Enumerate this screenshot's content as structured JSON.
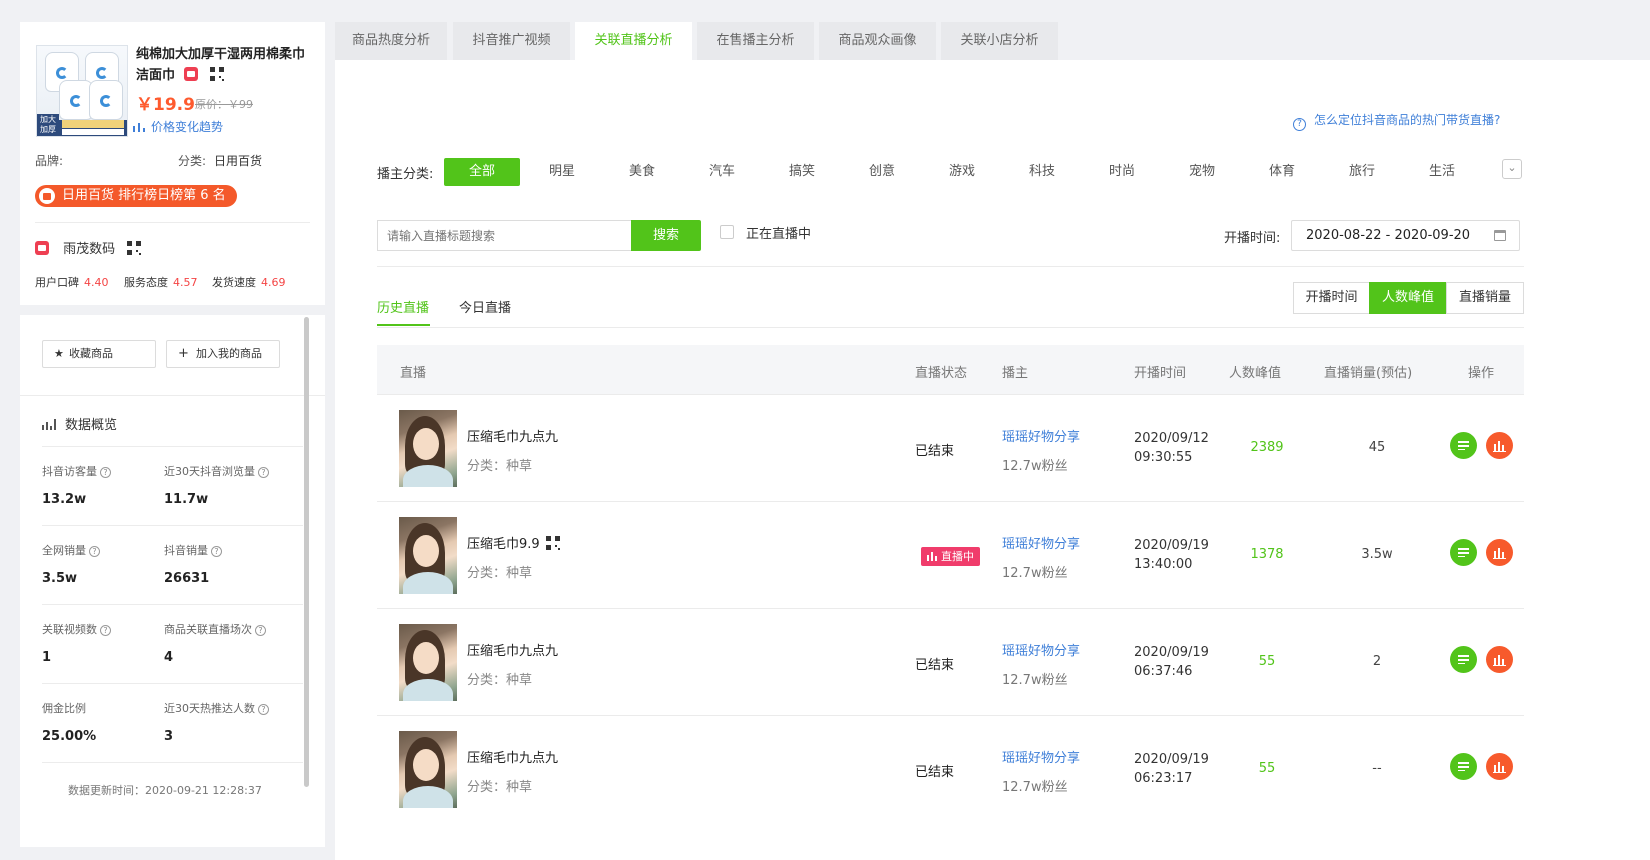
{
  "product": {
    "title": "纯棉加大加厚干湿两用棉柔巾洁面巾",
    "price": "￥19.9",
    "original_price": "原价：￥99",
    "price_trend": "价格变化趋势",
    "image_corner_text": "加大加厚",
    "brand_label": "品牌:",
    "category_label": "分类:",
    "category_value": "日用百货",
    "rank_badge": "日用百货 排行榜日榜第 6 名"
  },
  "shop": {
    "name": "雨茂数码",
    "scores": [
      {
        "label": "用户口碑",
        "value": "4.40"
      },
      {
        "label": "服务态度",
        "value": "4.57"
      },
      {
        "label": "发货速度",
        "value": "4.69"
      }
    ]
  },
  "actions": {
    "favorite": "收藏商品",
    "add_mine": "加入我的商品"
  },
  "overview": {
    "title": "数据概览",
    "stats": [
      {
        "label": "抖音访客量",
        "value": "13.2w"
      },
      {
        "label": "近30天抖音浏览量",
        "value": "11.7w"
      },
      {
        "label": "全网销量",
        "value": "3.5w"
      },
      {
        "label": "抖音销量",
        "value": "26631"
      },
      {
        "label": "关联视频数",
        "value": "1"
      },
      {
        "label": "商品关联直播场次",
        "value": "4"
      },
      {
        "label": "佣金比例",
        "value": "25.00%"
      },
      {
        "label": "近30天热推达人数",
        "value": "3"
      }
    ],
    "updated": "数据更新时间：2020-09-21 12:28:37"
  },
  "tabs": [
    "商品热度分析",
    "抖音推广视频",
    "关联直播分析",
    "在售播主分析",
    "商品观众画像",
    "关联小店分析"
  ],
  "active_tab": "关联直播分析",
  "help_link": "怎么定位抖音商品的热门带货直播?",
  "filters": {
    "category_label": "播主分类:",
    "categories": [
      "全部",
      "明星",
      "美食",
      "汽车",
      "搞笑",
      "创意",
      "游戏",
      "科技",
      "时尚",
      "宠物",
      "体育",
      "旅行",
      "生活"
    ],
    "search_placeholder": "请输入直播标题搜索",
    "search_button": "搜索",
    "live_only_label": "正在直播中",
    "date_label": "开播时间:",
    "date_range": "2020-08-22 - 2020-09-20"
  },
  "history_tabs": [
    "历史直播",
    "今日直播"
  ],
  "sort_buttons": [
    "开播时间",
    "人数峰值",
    "直播销量"
  ],
  "columns": [
    "直播",
    "直播状态",
    "播主",
    "开播时间",
    "人数峰值",
    "直播销量(预估)",
    "操作"
  ],
  "rows": [
    {
      "title": "压缩毛巾九点九",
      "category": "分类：种草",
      "status": "已结束",
      "host": "瑶瑶好物分享",
      "fans": "12.7w粉丝",
      "date": "2020/09/12",
      "time": "09:30:55",
      "peak": "2389",
      "sales": "45"
    },
    {
      "title": "压缩毛巾9.9",
      "category": "分类：种草",
      "status": "直播中",
      "host": "瑶瑶好物分享",
      "fans": "12.7w粉丝",
      "date": "2020/09/19",
      "time": "13:40:00",
      "peak": "1378",
      "sales": "3.5w"
    },
    {
      "title": "压缩毛巾九点九",
      "category": "分类：种草",
      "status": "已结束",
      "host": "瑶瑶好物分享",
      "fans": "12.7w粉丝",
      "date": "2020/09/19",
      "time": "06:37:46",
      "peak": "55",
      "sales": "2"
    },
    {
      "title": "压缩毛巾九点九",
      "category": "分类：种草",
      "status": "已结束",
      "host": "瑶瑶好物分享",
      "fans": "12.7w粉丝",
      "date": "2020/09/19",
      "time": "06:23:17",
      "peak": "55",
      "sales": "--"
    }
  ],
  "colors": {
    "accent_green": "#52c41a",
    "price_orange": "#fe5a2e",
    "link_blue": "#3f7fd8",
    "live_pink": "#f03c6b"
  }
}
